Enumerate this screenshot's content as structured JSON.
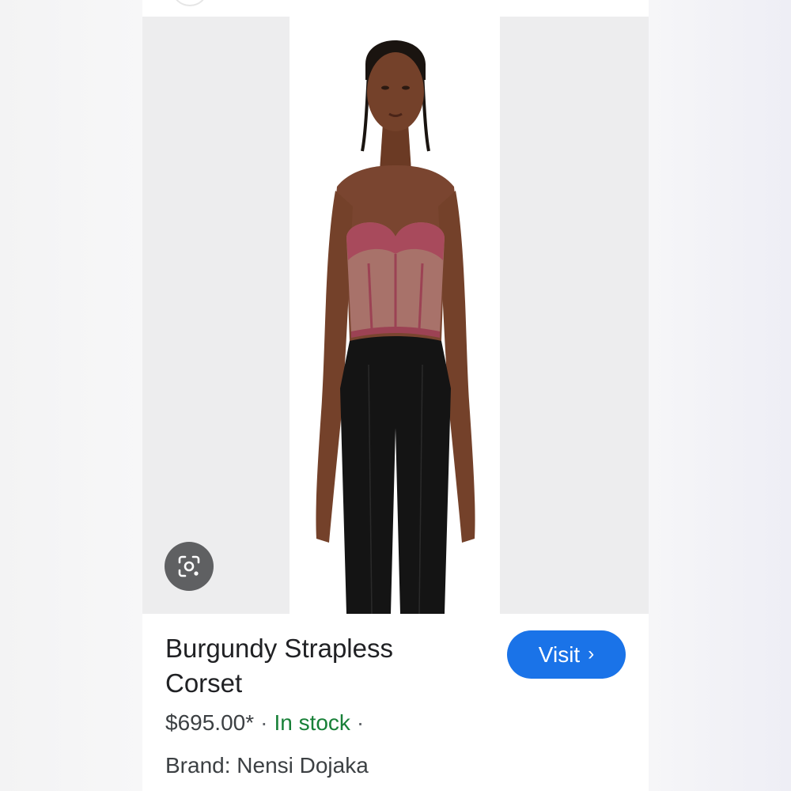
{
  "product": {
    "title": "Burgundy Strapless Corset",
    "price": "$695.00*",
    "separator": "·",
    "availability": "In stock",
    "trailing_separator": "·",
    "brand_label": "Brand: Nensi Dojaka"
  },
  "actions": {
    "visit_label": "Visit",
    "visit_chevron": "›"
  },
  "icons": {
    "lens": "google-lens-icon",
    "chevron": "chevron-right-icon"
  },
  "colors": {
    "visit_button": "#1a73e8",
    "in_stock": "#188038",
    "corset": "#a84a5c",
    "pants": "#141414",
    "lens_button": "#5f6062"
  }
}
